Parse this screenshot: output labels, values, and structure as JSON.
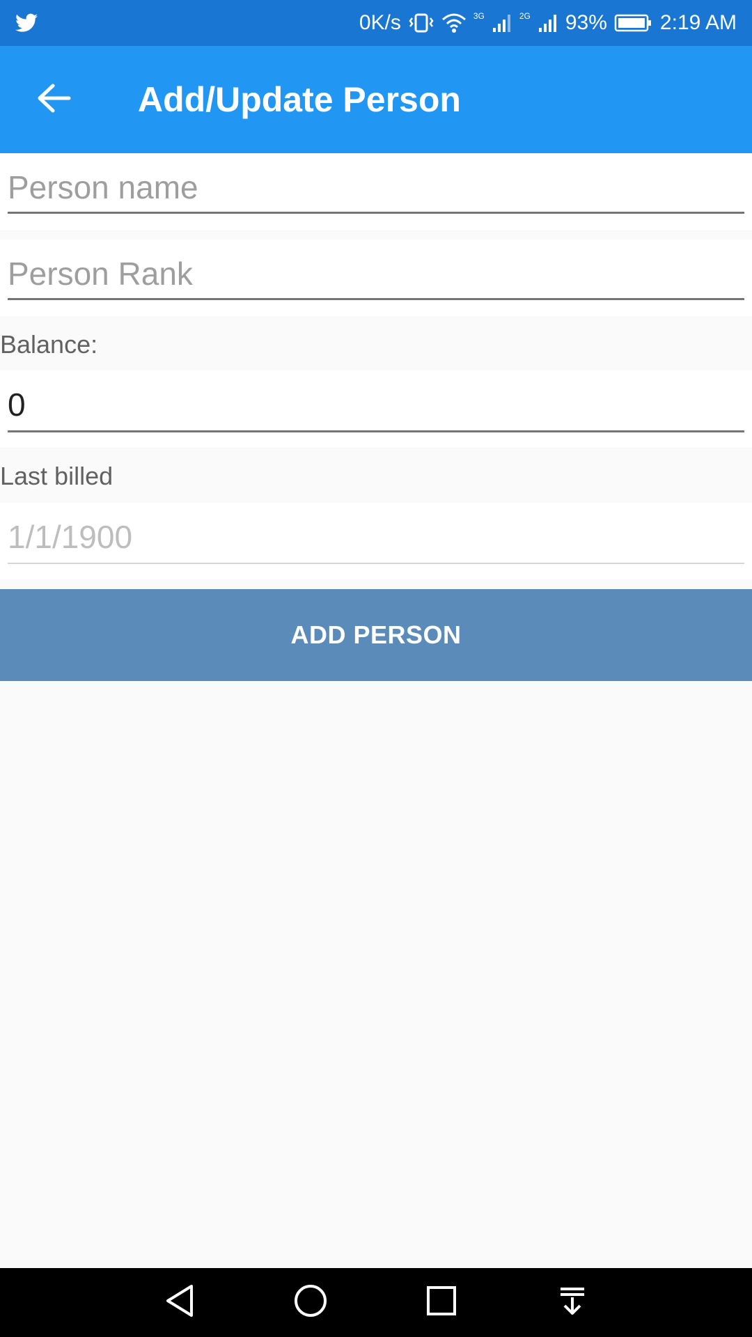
{
  "status_bar": {
    "speed": "0K/s",
    "net_3g": "3G",
    "net_2g": "2G",
    "battery": "93%",
    "time": "2:19 AM",
    "icons": [
      "twitter-icon",
      "vibrate-icon",
      "wifi-icon",
      "signal-icon",
      "battery-icon"
    ]
  },
  "app_bar": {
    "title": "Add/Update Person",
    "back_icon": "arrow-back-icon"
  },
  "form": {
    "person_name": {
      "placeholder": "Person name",
      "value": ""
    },
    "person_rank": {
      "placeholder": "Person Rank",
      "value": ""
    },
    "balance": {
      "label": "Balance:",
      "value": "0"
    },
    "last_billed": {
      "label": "Last billed",
      "placeholder": "1/1/1900"
    }
  },
  "actions": {
    "add_person_label": "ADD PERSON"
  },
  "nav_bar": {
    "icons": [
      "back-triangle-icon",
      "home-circle-icon",
      "recents-square-icon",
      "notification-pull-icon"
    ]
  },
  "colors": {
    "status_bar": "#1976d2",
    "app_bar": "#2196f3",
    "button": "#5b8bb8",
    "background": "#fafafa"
  }
}
